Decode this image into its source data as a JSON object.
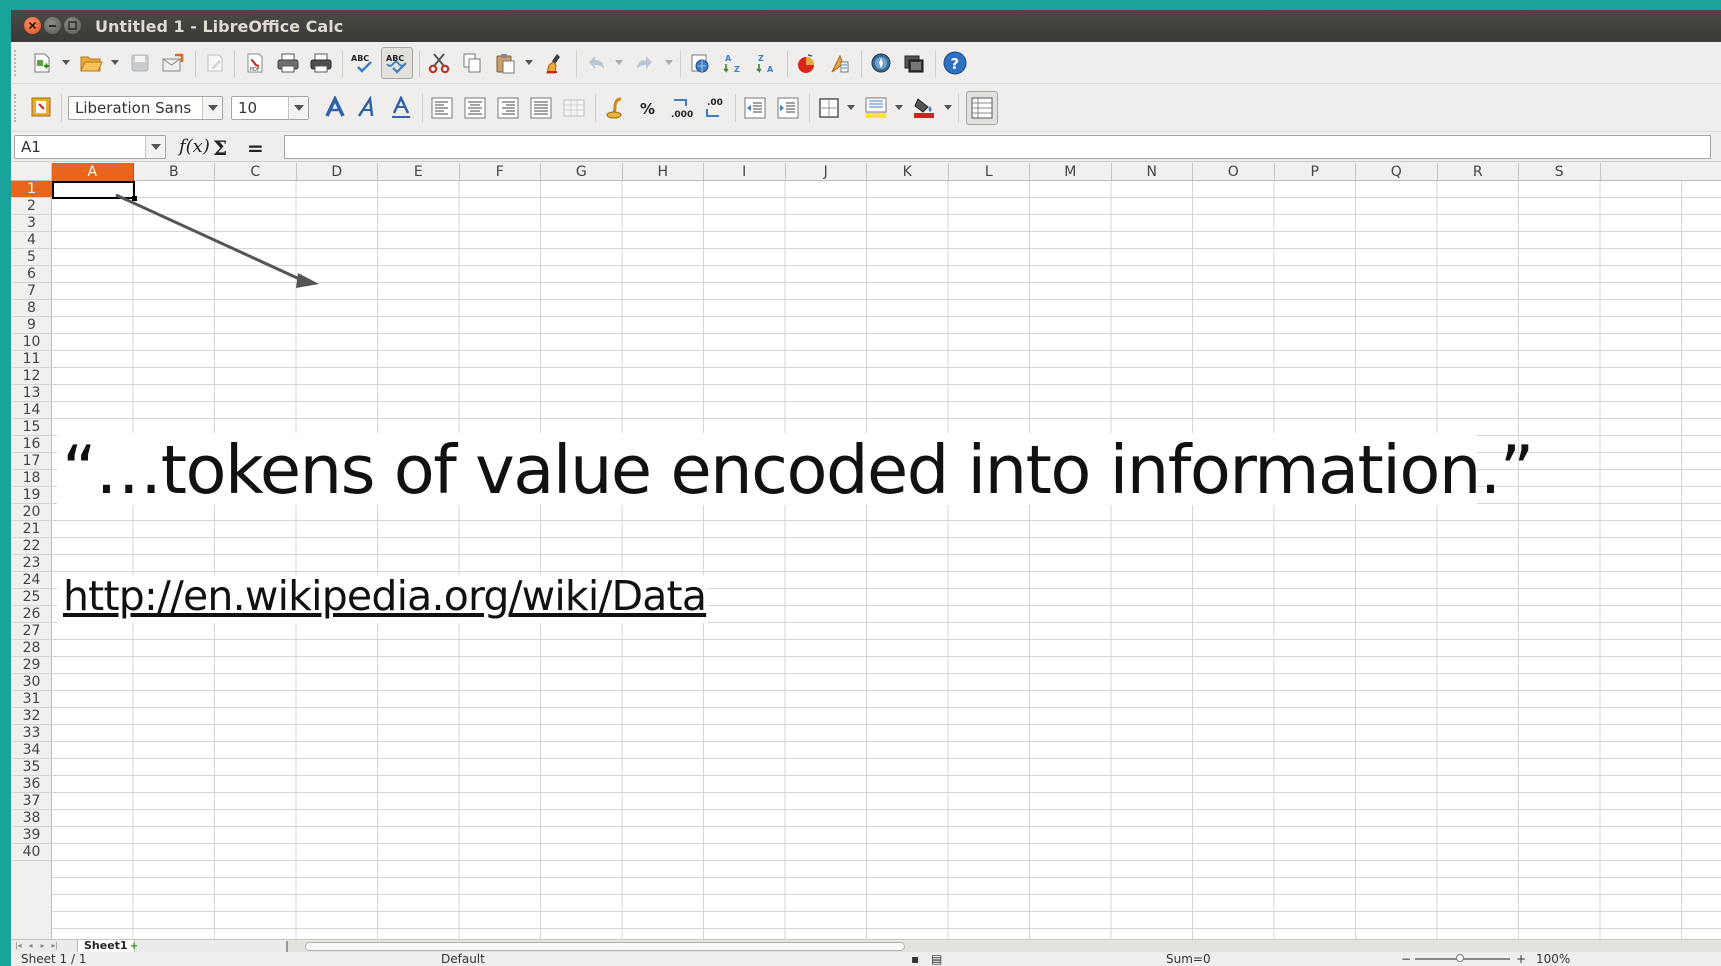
{
  "window": {
    "title": "Untitled 1 - LibreOffice Calc"
  },
  "toolbar": {
    "font_name": "Liberation Sans",
    "font_size": "10",
    "icons": [
      "new-icon",
      "open-icon",
      "save-icon",
      "email-icon",
      "edit-file-icon",
      "export-pdf-icon",
      "print-icon",
      "print-preview-icon",
      "spellcheck-icon",
      "autospellcheck-icon",
      "cut-icon",
      "copy-icon",
      "paste-icon",
      "clone-format-icon",
      "undo-icon",
      "redo-icon",
      "hyperlink-icon",
      "sort-ascending-icon",
      "sort-descending-icon",
      "chart-icon",
      "draw-functions-icon",
      "navigator-icon",
      "gallery-icon",
      "help-icon"
    ],
    "format_icons": [
      "styles-icon",
      "bold-icon",
      "italic-icon",
      "underline-icon",
      "align-left-icon",
      "align-center-icon",
      "align-right-icon",
      "justify-icon",
      "merge-cells-icon",
      "currency-icon",
      "percent-icon",
      "add-decimal-icon",
      "delete-decimal-icon",
      "decrease-indent-icon",
      "increase-indent-icon",
      "borders-icon",
      "background-color-icon",
      "font-color-icon",
      "toggle-grid-icon"
    ]
  },
  "formula_bar": {
    "name_box": "A1",
    "function_wizard": "f(x)",
    "sum_symbol": "Σ",
    "equals_symbol": "=",
    "formula": ""
  },
  "sheet": {
    "columns": [
      "A",
      "B",
      "C",
      "D",
      "E",
      "F",
      "G",
      "H",
      "I",
      "J",
      "K",
      "L",
      "M",
      "N",
      "O",
      "P",
      "Q",
      "R",
      "S"
    ],
    "rows": [
      "1",
      "2",
      "3",
      "4",
      "5",
      "6",
      "7",
      "8",
      "9",
      "10",
      "11",
      "12",
      "13",
      "14",
      "15",
      "16",
      "17",
      "18",
      "19",
      "20",
      "21",
      "22",
      "23",
      "24",
      "25",
      "26",
      "27",
      "28",
      "29",
      "30",
      "31",
      "32",
      "33",
      "34",
      "35",
      "36",
      "37",
      "38",
      "39",
      "40"
    ],
    "active_column": "A",
    "active_row": "1"
  },
  "overlay": {
    "quote": "“…tokens of value encoded into information.”",
    "url": "http://en.wikipedia.org/wiki/Data"
  },
  "tabs": {
    "sheet_tab": "Sheet1",
    "add_sheet": "+"
  },
  "status": {
    "sheet": "Sheet 1 / 1",
    "style": "Default",
    "sum": "Sum=0",
    "zoom_minus": "−",
    "zoom_plus": "+",
    "zoom": "100%"
  },
  "colors": {
    "accent": "#e8651b",
    "desktop": "#1aa39b",
    "titlebar": "#3c3b37"
  }
}
